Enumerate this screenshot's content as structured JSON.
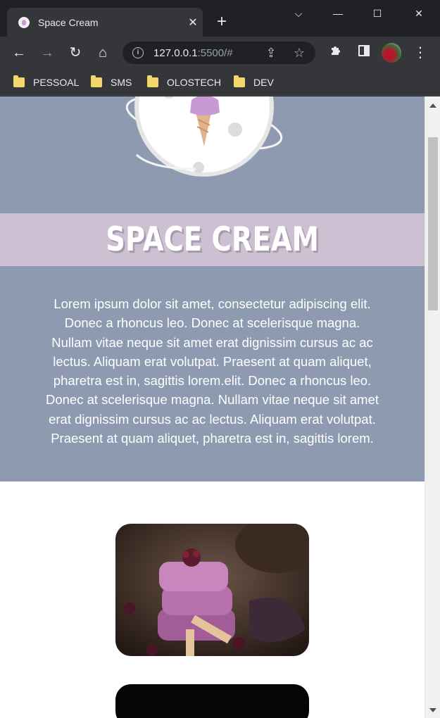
{
  "browser": {
    "tab_title": "Space Cream",
    "url_host": "127.0.0.1",
    "url_rest": ":5500/#",
    "bookmarks": [
      "PESSOAL",
      "SMS",
      "OLOSTECH",
      "DEV"
    ]
  },
  "page": {
    "title": "SPACE CREAM",
    "intro": "Lorem ipsum dolor sit amet, consectetur adipiscing elit. Donec a rhoncus leo. Donec at scelerisque magna. Nullam vitae neque sit amet erat dignissim cursus ac ac lectus. Aliquam erat volutpat. Praesent at quam aliquet, pharetra est in, sagittis lorem.elit. Donec a rhoncus leo. Donec at scelerisque magna. Nullam vitae neque sit amet erat dignissim cursus ac ac lectus. Aliquam erat volutpat. Praesent at quam aliquet, pharetra est in, sagittis lorem."
  },
  "colors": {
    "hero_bg": "#8d9ab0",
    "title_band_bg": "#cdc0d3",
    "ice_cream": "#c79ad6"
  },
  "icons": {
    "back": "arrow-left-icon",
    "forward": "arrow-right-icon",
    "reload": "reload-icon",
    "home": "home-icon",
    "info": "info-icon",
    "share": "share-icon",
    "bookmark": "star-icon",
    "extensions": "puzzle-icon",
    "side_panel": "side-panel-icon",
    "menu": "kebab-menu-icon"
  }
}
